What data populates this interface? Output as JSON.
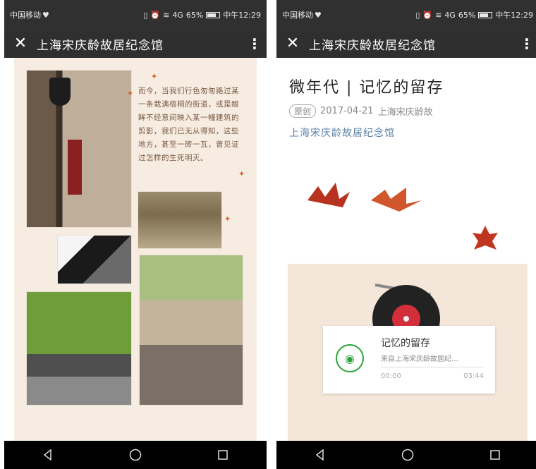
{
  "status": {
    "carrier": "中国移动",
    "battery": "65%",
    "time": "中午12:29",
    "signal": "4G",
    "battery_level": 0.65
  },
  "titlebar": {
    "title": "上海宋庆龄故居纪念馆"
  },
  "left": {
    "poem": "而今，当我们行色匆匆路过某一条栽满梧桐的街道，或是眼眸不经意间映入某一幢建筑的剪影，我们已无从得知，这些地方，甚至一砖一瓦，曾见证过怎样的生死明灭。"
  },
  "right": {
    "article_title": "微年代 | 记忆的留存",
    "tag": "原创",
    "date": "2017-04-21",
    "source": "上海宋庆龄故",
    "author": "上海宋庆龄故居纪念馆",
    "player": {
      "song": "记忆的留存",
      "from": "来自上海宋庆龄故居纪…",
      "time_start": "00:00",
      "time_end": "03:44"
    }
  },
  "icons": {
    "close": "close-icon",
    "more": "more-vertical-icon",
    "back": "back-triangle-icon",
    "home": "home-circle-icon",
    "recents": "recents-square-icon",
    "play": "audio-play-icon"
  },
  "colors": {
    "titlebar": "#2f2f2f",
    "player_accent": "#2aa639",
    "link": "#5a7fa6"
  }
}
